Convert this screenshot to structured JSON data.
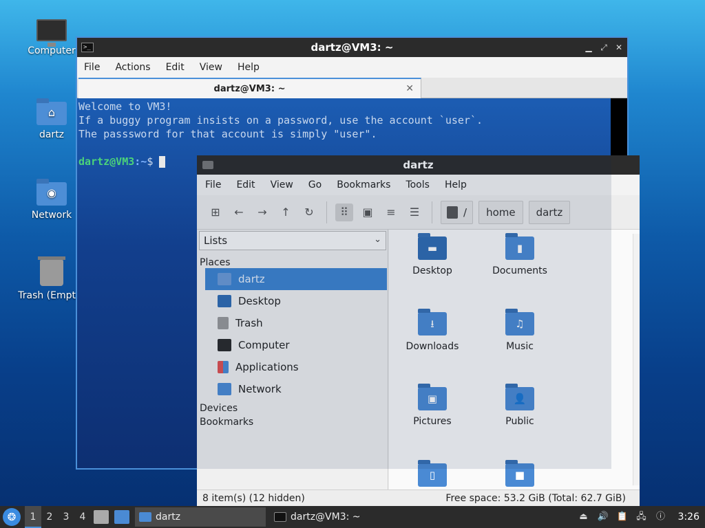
{
  "desktop": {
    "icons": [
      {
        "label": "Computer",
        "icon": "computer-icon"
      },
      {
        "label": "dartz",
        "icon": "home-folder-icon"
      },
      {
        "label": "Network",
        "icon": "network-folder-icon"
      },
      {
        "label": "Trash (Empty)",
        "icon": "trash-icon"
      }
    ]
  },
  "terminal": {
    "title": "dartz@VM3: ~",
    "menu": [
      "File",
      "Actions",
      "Edit",
      "View",
      "Help"
    ],
    "tab_label": "dartz@VM3: ~",
    "lines": [
      "Welcome to VM3!",
      "If a buggy program insists on a password, use the account `user`.",
      "The passsword for that account is simply \"user\"."
    ],
    "prompt_user": "dartz@VM3",
    "prompt_path": ":~",
    "prompt_symbol": "$"
  },
  "file_manager": {
    "title": "dartz",
    "menu": [
      "File",
      "Edit",
      "View",
      "Go",
      "Bookmarks",
      "Tools",
      "Help"
    ],
    "path": {
      "root": "/",
      "segments": [
        "home",
        "dartz"
      ]
    },
    "side_select": "Lists",
    "places_label": "Places",
    "places": [
      {
        "label": "dartz",
        "icon": "home-folder-icon",
        "selected": true
      },
      {
        "label": "Desktop",
        "icon": "desktop-icon",
        "selected": false
      },
      {
        "label": "Trash",
        "icon": "trash-icon",
        "selected": false
      },
      {
        "label": "Computer",
        "icon": "computer-icon",
        "selected": false
      },
      {
        "label": "Applications",
        "icon": "applications-icon",
        "selected": false
      },
      {
        "label": "Network",
        "icon": "network-icon",
        "selected": false
      }
    ],
    "devices_label": "Devices",
    "bookmarks_label": "Bookmarks",
    "items": [
      {
        "label": "Desktop",
        "glyph": "▬"
      },
      {
        "label": "Documents",
        "glyph": "▮"
      },
      {
        "label": "Downloads",
        "glyph": "⭳"
      },
      {
        "label": "Music",
        "glyph": "♫"
      },
      {
        "label": "Pictures",
        "glyph": "▣"
      },
      {
        "label": "Public",
        "glyph": "👤"
      },
      {
        "label": "",
        "glyph": "▯"
      },
      {
        "label": "",
        "glyph": "■"
      }
    ],
    "status_left": "8 item(s) (12 hidden)",
    "status_right": "Free space: 53.2 GiB (Total: 62.7 GiB)"
  },
  "taskbar": {
    "workspaces": [
      "1",
      "2",
      "3",
      "4"
    ],
    "active_workspace": "1",
    "tasks": [
      {
        "label": "dartz",
        "icon": "folder-icon"
      },
      {
        "label": "dartz@VM3: ~",
        "icon": "terminal-icon"
      }
    ],
    "clock": "3:26"
  },
  "colors": {
    "accent": "#4a90d9",
    "selection": "#3d83d0",
    "folder": "#4a8ad4"
  }
}
